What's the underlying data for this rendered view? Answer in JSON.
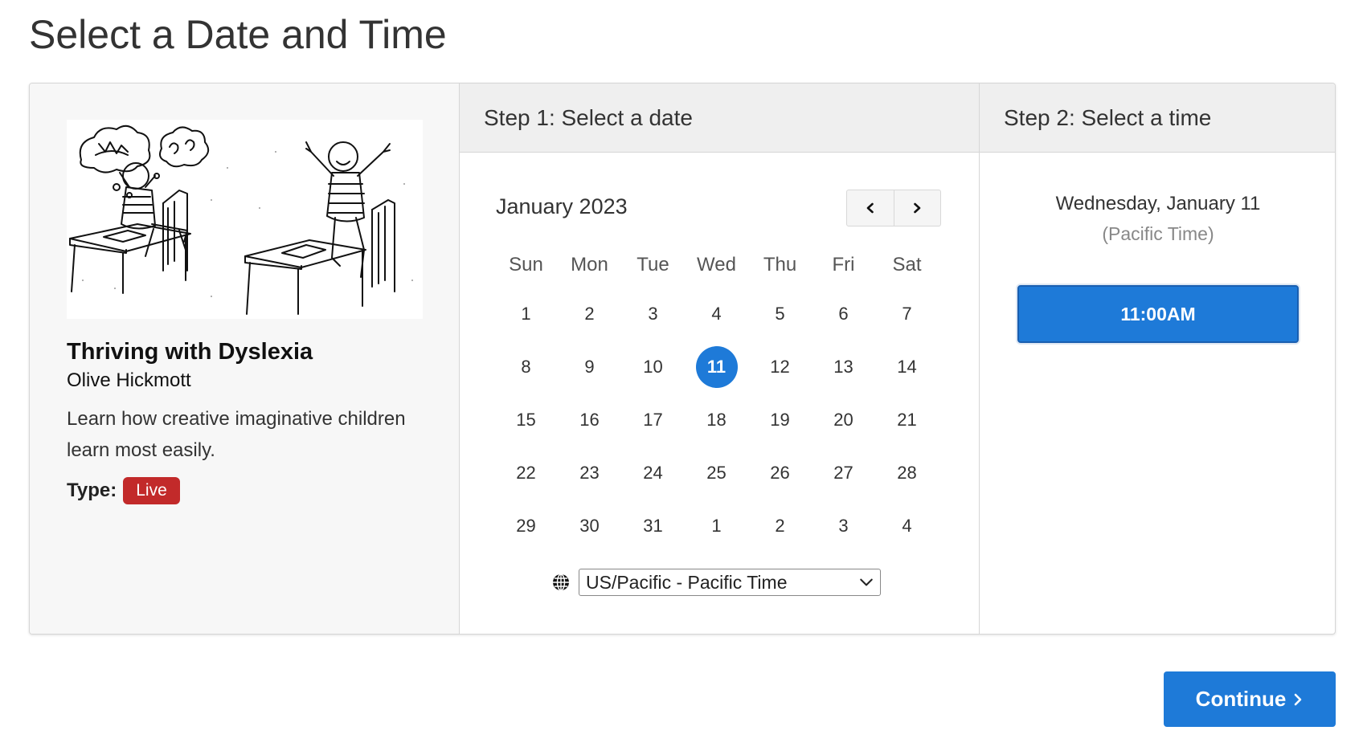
{
  "page": {
    "title": "Select a Date and Time"
  },
  "event": {
    "title": "Thriving with Dyslexia",
    "author": "Olive Hickmott",
    "description": "Learn how creative imaginative children learn most easily.",
    "type_label": "Type:",
    "type_value": "Live",
    "image_icon": "classroom-illustration"
  },
  "step1": {
    "header": "Step 1: Select a date",
    "month": "January 2023",
    "prev_icon": "chevron-left-icon",
    "next_icon": "chevron-right-icon",
    "weekdays": [
      "Sun",
      "Mon",
      "Tue",
      "Wed",
      "Thu",
      "Fri",
      "Sat"
    ],
    "days": [
      "1",
      "2",
      "3",
      "4",
      "5",
      "6",
      "7",
      "8",
      "9",
      "10",
      "11",
      "12",
      "13",
      "14",
      "15",
      "16",
      "17",
      "18",
      "19",
      "20",
      "21",
      "22",
      "23",
      "24",
      "25",
      "26",
      "27",
      "28",
      "29",
      "30",
      "31",
      "1",
      "2",
      "3",
      "4"
    ],
    "selected_day": "11",
    "timezone_icon": "globe-icon",
    "timezone_value": "US/Pacific - Pacific Time"
  },
  "step2": {
    "header": "Step 2: Select a time",
    "selected_date": "Wednesday, January 11",
    "timezone_note": "(Pacific Time)",
    "slots": [
      "11:00AM"
    ]
  },
  "actions": {
    "continue_label": "Continue"
  },
  "colors": {
    "accent": "#1e7ad8",
    "live_badge": "#c22a2a",
    "panel_bg": "#f7f7f7",
    "header_bg": "#efefef"
  }
}
